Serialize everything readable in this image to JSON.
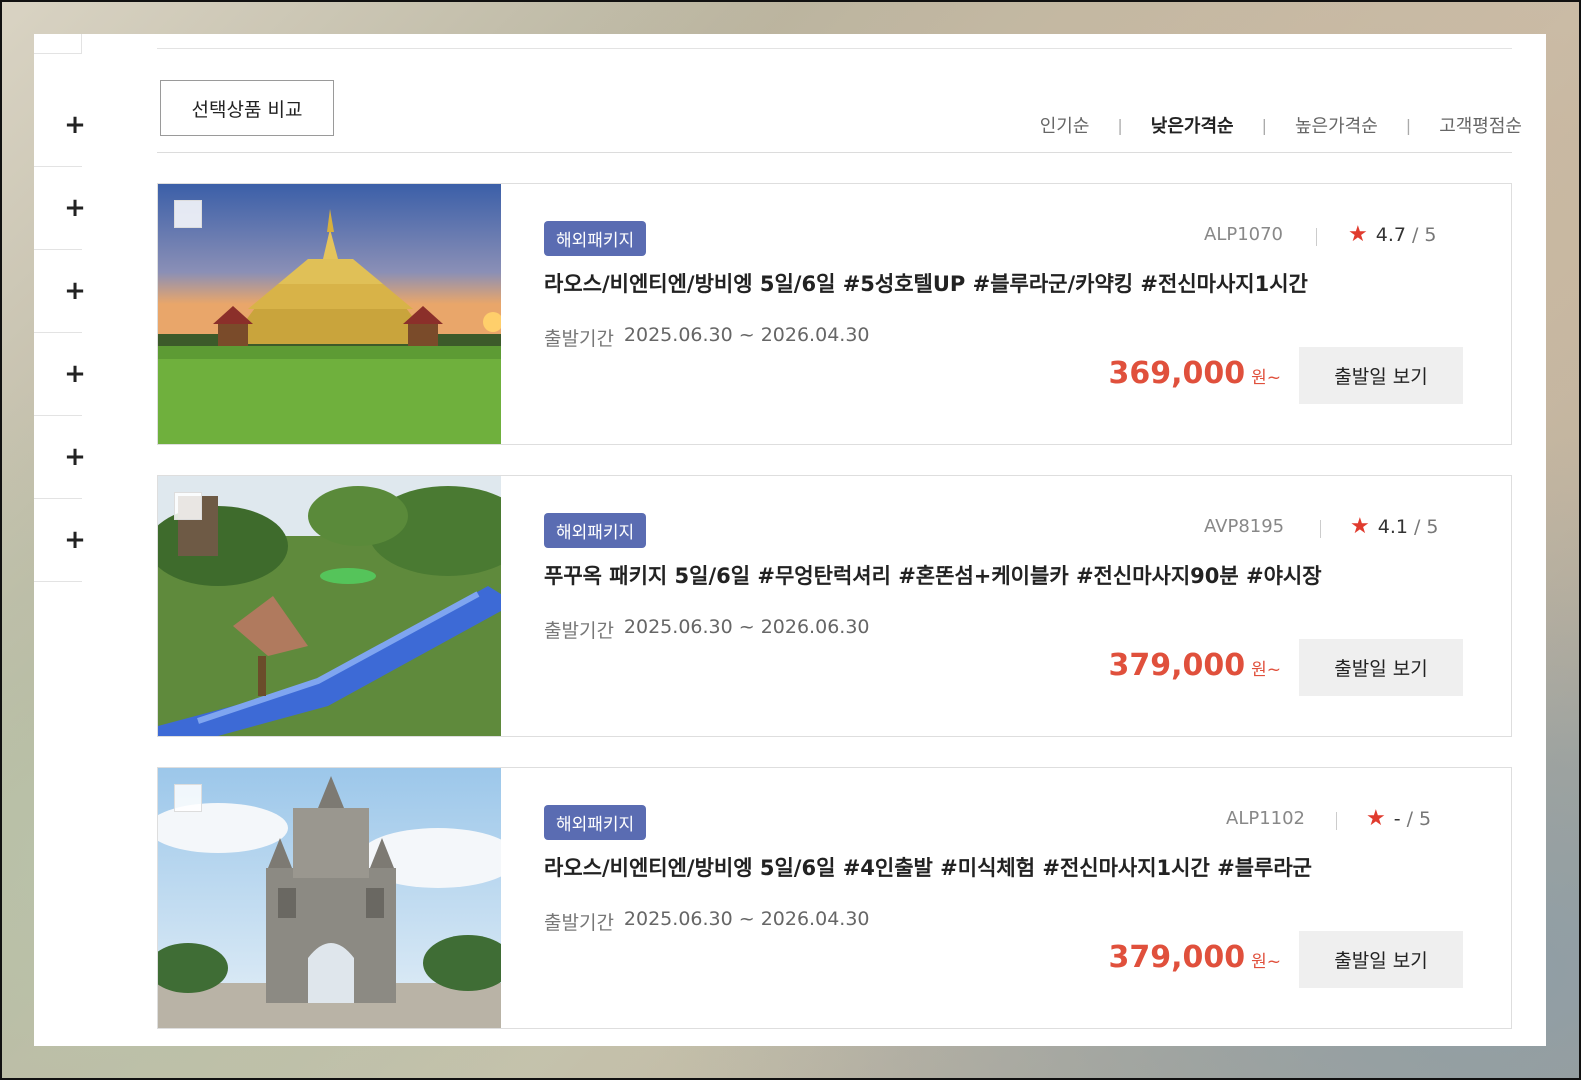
{
  "sidebar": {
    "items": [
      {
        "icon": "plus-icon",
        "label": "+"
      },
      {
        "icon": "plus-icon",
        "label": "+"
      },
      {
        "icon": "plus-icon",
        "label": "+"
      },
      {
        "icon": "plus-icon",
        "label": "+"
      },
      {
        "icon": "plus-icon",
        "label": "+"
      },
      {
        "icon": "plus-icon",
        "label": "+"
      }
    ]
  },
  "toolbar": {
    "compare_label": "선택상품 비교"
  },
  "sort": {
    "options": [
      {
        "label": "인기순",
        "active": false
      },
      {
        "label": "낮은가격순",
        "active": true
      },
      {
        "label": "높은가격순",
        "active": false
      },
      {
        "label": "고객평점순",
        "active": false
      }
    ]
  },
  "products": [
    {
      "badge": "해외패키지",
      "code": "ALP1070",
      "rating": "4.7",
      "rating_max": "/ 5",
      "title": "라오스/비엔티엔/방비엥 5일/6일 #5성호텔UP #블루라군/카약킹 #전신마사지1시간",
      "period_label": "출발기간",
      "period": "2025.06.30 ~ 2026.04.30",
      "price": "369,000",
      "unit": "원~",
      "button": "출발일 보기",
      "image": "golden-stupa"
    },
    {
      "badge": "해외패키지",
      "code": "AVP8195",
      "rating": "4.1",
      "rating_max": "/ 5",
      "title": "푸꾸옥 패키지 5일/6일 #무엉탄럭셔리 #혼똔섬+케이블카 #전신마사지90분 #야시장",
      "period_label": "출발기간",
      "period": "2025.06.30 ~ 2026.06.30",
      "price": "379,000",
      "unit": "원~",
      "button": "출발일 보기",
      "image": "resort-lazy-river"
    },
    {
      "badge": "해외패키지",
      "code": "ALP1102",
      "rating": "-",
      "rating_max": "/ 5",
      "title": "라오스/비엔티엔/방비엥 5일/6일 #4인출발 #미식체험 #전신마사지1시간 #블루라군",
      "period_label": "출발기간",
      "period": "2025.06.30 ~ 2026.04.30",
      "price": "379,000",
      "unit": "원~",
      "button": "출발일 보기",
      "image": "victory-gate"
    }
  ],
  "colors": {
    "badge": "#5a6cb2",
    "price": "#e0503c",
    "star": "#e03b2e"
  }
}
